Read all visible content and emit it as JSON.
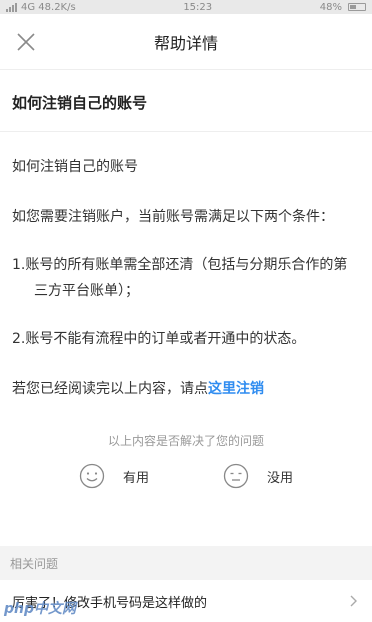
{
  "status_bar": {
    "left_text": "4G 48.2K/s",
    "time": "15:23",
    "battery": "48%"
  },
  "nav": {
    "title": "帮助详情",
    "close_icon": "close-icon"
  },
  "article": {
    "title": "如何注销自己的账号",
    "subtitle": "如何注销自己的账号",
    "intro": "如您需要注销账户，当前账号需满足以下两个条件：",
    "items": [
      "1.账号的所有账单需全部还清（包括与分期乐合作的第三方平台账单）；",
      "2.账号不能有流程中的订单或者开通中的状态。"
    ],
    "closing_prefix": "若您已经阅读完以上内容，请点",
    "closing_link": "这里注销"
  },
  "feedback": {
    "question": "以上内容是否解决了您的问题",
    "useful_label": "有用",
    "useless_label": "没用",
    "useful_icon": "smile-face-icon",
    "useless_icon": "neutral-face-icon"
  },
  "related": {
    "header": "相关问题",
    "items": [
      {
        "label": "厉害了！修改手机号码是这样做的"
      }
    ]
  },
  "colors": {
    "accent_link": "#2f8cf0",
    "divider": "#eeeeee",
    "section_bg": "#f3f3f3"
  }
}
